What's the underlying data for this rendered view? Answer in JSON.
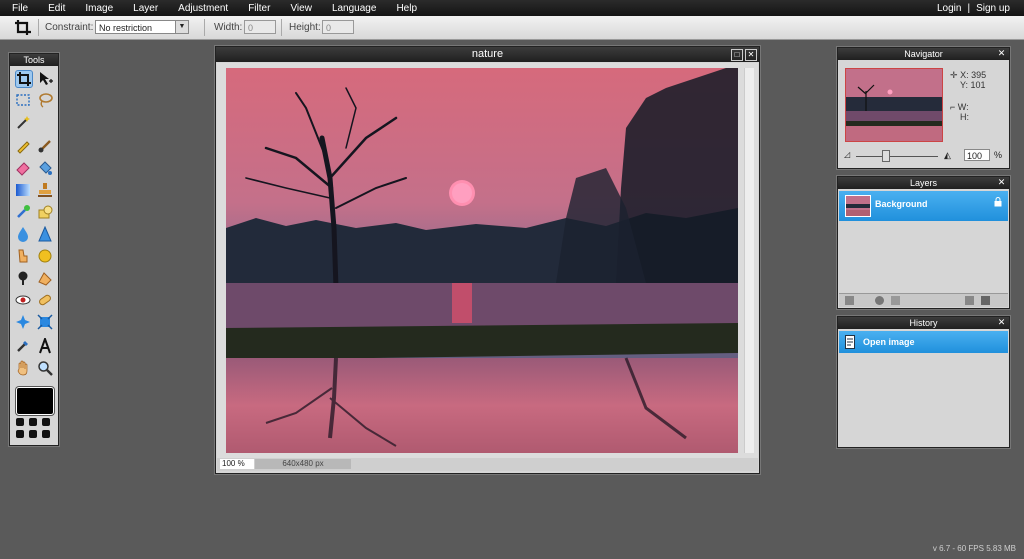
{
  "menu": {
    "items": [
      "File",
      "Edit",
      "Image",
      "Layer",
      "Adjustment",
      "Filter",
      "View",
      "Language",
      "Help"
    ],
    "login": "Login",
    "separator": "|",
    "signup": "Sign up"
  },
  "options": {
    "constraint_label": "Constraint:",
    "constraint_value": "No restriction",
    "width_label": "Width:",
    "width_value": "0",
    "height_label": "Height:",
    "height_value": "0"
  },
  "tools": {
    "title": "Tools",
    "icons": [
      "crop-icon",
      "move-icon",
      "marquee-icon",
      "lasso-icon",
      "wand-icon",
      "pencil-icon",
      "brush-icon",
      "eraser-icon",
      "bucket-icon",
      "gradient-icon",
      "stamp-icon",
      "color-replace-icon",
      "drawing-icon",
      "blur-icon",
      "sharpen-icon",
      "smudge-icon",
      "sponge-icon",
      "dodge-icon",
      "burn-icon",
      "redeye-icon",
      "spot-heal-icon",
      "bloat-icon",
      "pinch-icon",
      "color-picker-icon",
      "type-icon",
      "hand-icon",
      "zoom-icon"
    ],
    "primary_color": "#000000"
  },
  "canvas": {
    "title": "nature",
    "zoom": "100 %",
    "dimensions": "640x480 px"
  },
  "navigator": {
    "title": "Navigator",
    "x_label": "X:",
    "x_value": "395",
    "y_label": "Y:",
    "y_value": "101",
    "w_label": "W:",
    "h_label": "H:",
    "zoom_value": "100",
    "zoom_unit": "%"
  },
  "layers": {
    "title": "Layers",
    "items": [
      {
        "label": "Background"
      }
    ]
  },
  "history": {
    "title": "History",
    "items": [
      {
        "label": "Open image"
      }
    ]
  },
  "stats": "v 6.7 - 60 FPS 5.83 MB",
  "colors": {
    "accent": "#2a98e0",
    "panel": "#d6d6d6",
    "workspace": "#5a5a5a"
  }
}
